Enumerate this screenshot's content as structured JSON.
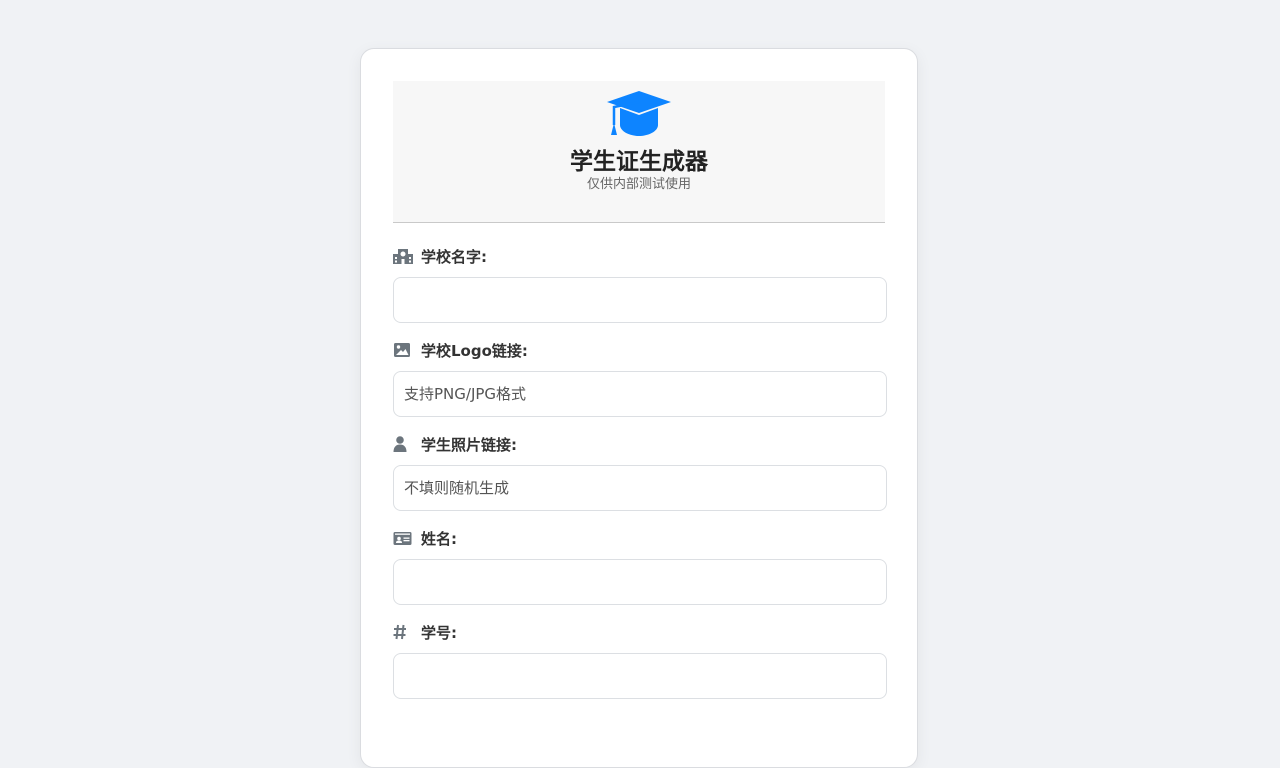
{
  "header": {
    "icon": "graduation-cap-icon",
    "title": "学生证生成器",
    "subtitle": "仅供内部测试使用",
    "accent_color": "#0d84ff"
  },
  "form": {
    "fields": [
      {
        "icon": "school-icon",
        "label": "学校名字:",
        "value": "",
        "placeholder": ""
      },
      {
        "icon": "image-icon",
        "label": "学校Logo链接:",
        "value": "",
        "placeholder": "支持PNG/JPG格式"
      },
      {
        "icon": "user-icon",
        "label": "学生照片链接:",
        "value": "",
        "placeholder": "不填则随机生成"
      },
      {
        "icon": "id-card-icon",
        "label": "姓名:",
        "value": "",
        "placeholder": ""
      },
      {
        "icon": "hashtag-icon",
        "label": "学号:",
        "value": "",
        "placeholder": ""
      }
    ]
  }
}
